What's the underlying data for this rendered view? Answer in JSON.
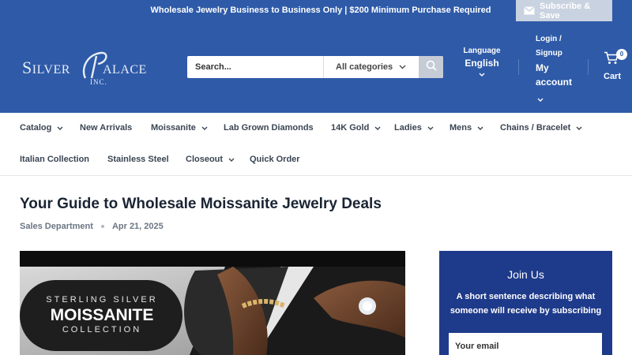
{
  "announcement": {
    "text": "Wholesale Jewelry Business to Business Only | $200 Minimum Purchase Required",
    "subscribe_label": "Subscribe & Save"
  },
  "header": {
    "logo_text": "SILVER PALACE",
    "logo_subtext": "INC.",
    "search_placeholder": "Search...",
    "category_select": "All categories",
    "language_label": "Language",
    "language_value": "English",
    "login_label": "Login / Signup",
    "account_label": "My account",
    "cart_label": "Cart",
    "cart_count": "0"
  },
  "nav": {
    "items": [
      {
        "label": "Catalog",
        "dropdown": true
      },
      {
        "label": "New Arrivals",
        "dropdown": false
      },
      {
        "label": "Moissanite",
        "dropdown": true
      },
      {
        "label": "Lab Grown Diamonds",
        "dropdown": false
      },
      {
        "label": "14K Gold",
        "dropdown": true
      },
      {
        "label": "Ladies",
        "dropdown": true
      },
      {
        "label": "Mens",
        "dropdown": true
      },
      {
        "label": "Chains / Bracelet",
        "dropdown": true
      },
      {
        "label": "Italian Collection",
        "dropdown": false
      },
      {
        "label": "Stainless Steel",
        "dropdown": false
      },
      {
        "label": "Closeout",
        "dropdown": true
      },
      {
        "label": "Quick Order",
        "dropdown": false
      }
    ]
  },
  "article": {
    "title": "Your Guide to Wholesale Moissanite Jewelry Deals",
    "author": "Sales Department",
    "date": "Apr 21, 2025",
    "banner": {
      "line1": "STERLING SILVER",
      "line2": "MOISSANITE",
      "line3": "COLLECTION"
    }
  },
  "sidebar": {
    "title": "Join Us",
    "text": "A short sentence describing what someone will receive by subscribing",
    "email_placeholder": "Your email"
  },
  "colors": {
    "brand_blue": "#2e5aa8",
    "sidebar_blue": "#1e3a8a"
  }
}
